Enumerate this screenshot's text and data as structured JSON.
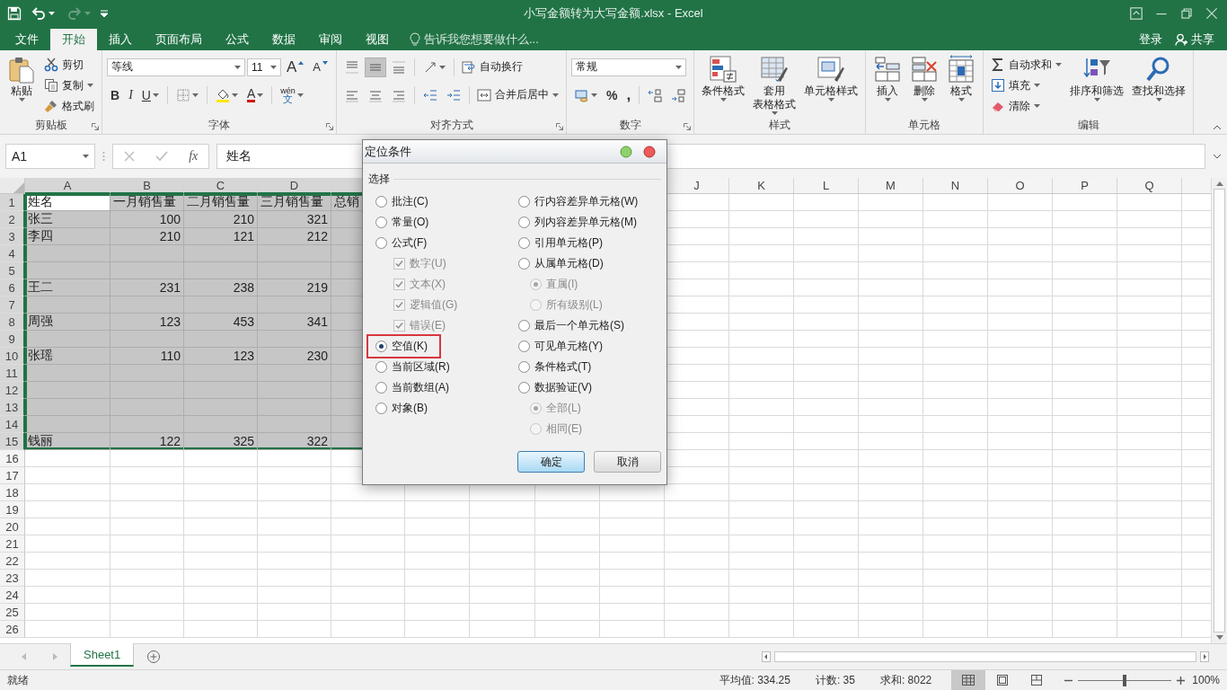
{
  "title_bar": {
    "title": "小写金额转为大写金额.xlsx - Excel",
    "redo_disabled": true
  },
  "tabs": [
    {
      "label": "文件",
      "selected": false
    },
    {
      "label": "开始",
      "selected": true
    },
    {
      "label": "插入",
      "selected": false
    },
    {
      "label": "页面布局",
      "selected": false
    },
    {
      "label": "公式",
      "selected": false
    },
    {
      "label": "数据",
      "selected": false
    },
    {
      "label": "审阅",
      "selected": false
    },
    {
      "label": "视图",
      "selected": false
    }
  ],
  "tell_me": "告诉我您想要做什么...",
  "sign_in": "登录",
  "share": "共享",
  "ribbon": {
    "groups": [
      {
        "label": "剪贴板",
        "launcher": true,
        "columns": [
          {
            "kind": "large",
            "lines": [
              "粘贴"
            ],
            "dropdown": true
          },
          {
            "kind": "stack",
            "items": [
              {
                "kind": "small",
                "label": "剪切",
                "dropdown": false
              },
              {
                "kind": "small",
                "label": "复制",
                "dropdown": true
              },
              {
                "kind": "small",
                "label": "格式刷",
                "dropdown": false
              }
            ]
          }
        ]
      },
      {
        "label": "字体",
        "launcher": true,
        "columns": [
          {
            "kind": "rows",
            "rows": [
              {
                "controls": [
                  {
                    "kind": "field",
                    "value": "等线"
                  },
                  {
                    "kind": "field",
                    "value": "11"
                  },
                  {
                    "kind": "glyph",
                    "text": "A",
                    "dropdown": false
                  },
                  {
                    "kind": "glyph",
                    "text": "A",
                    "dropdown": false
                  }
                ]
              },
              {
                "controls": [
                  {
                    "kind": "glyph",
                    "text": "B",
                    "dropdown": false
                  },
                  {
                    "kind": "glyph",
                    "text": "I",
                    "dropdown": false
                  },
                  {
                    "kind": "glyph",
                    "text": "U",
                    "dropdown": true
                  },
                  {
                    "kind": "separator"
                  },
                  {
                    "kind": "icon",
                    "dropdown": true
                  },
                  {
                    "kind": "separator"
                  },
                  {
                    "kind": "icon",
                    "dropdown": true
                  },
                  {
                    "kind": "glyph",
                    "text": "A",
                    "dropdown": true
                  },
                  {
                    "kind": "separator"
                  },
                  {
                    "kind": "glyph",
                    "text": "文",
                    "ruby": "wén",
                    "dropdown": true
                  }
                ]
              }
            ]
          }
        ]
      },
      {
        "label": "对齐方式",
        "launcher": true,
        "columns": [
          {
            "kind": "rows",
            "rows": [
              {
                "controls": [
                  {
                    "kind": "icon",
                    "dropdown": false,
                    "selected": false
                  },
                  {
                    "kind": "icon",
                    "dropdown": false,
                    "selected": true
                  },
                  {
                    "kind": "icon",
                    "dropdown": false,
                    "selected": false
                  },
                  {
                    "kind": "separator"
                  },
                  {
                    "kind": "icon",
                    "dropdown": true
                  },
                  {
                    "kind": "separator"
                  },
                  {
                    "kind": "small",
                    "label": "自动换行",
                    "dropdown": false
                  }
                ]
              },
              {
                "controls": [
                  {
                    "kind": "icon",
                    "dropdown": false,
                    "selected": false
                  },
                  {
                    "kind": "icon",
                    "dropdown": false,
                    "selected": false
                  },
                  {
                    "kind": "icon",
                    "dropdown": false,
                    "selected": false
                  },
                  {
                    "kind": "separator"
                  },
                  {
                    "kind": "icon",
                    "dropdown": false
                  },
                  {
                    "kind": "icon",
                    "dropdown": false
                  },
                  {
                    "kind": "separator"
                  },
                  {
                    "kind": "small",
                    "label": "合并后居中",
                    "dropdown": true
                  }
                ]
              }
            ]
          }
        ]
      },
      {
        "label": "数字",
        "launcher": true,
        "columns": [
          {
            "kind": "rows",
            "rows": [
              {
                "controls": [
                  {
                    "kind": "field",
                    "value": "常规"
                  }
                ]
              },
              {
                "controls": [
                  {
                    "kind": "icon",
                    "dropdown": true
                  },
                  {
                    "kind": "glyph",
                    "text": "%",
                    "dropdown": false
                  },
                  {
                    "kind": "glyph",
                    "text": ",",
                    "dropdown": false
                  },
                  {
                    "kind": "separator"
                  },
                  {
                    "kind": "icon",
                    "dropdown": false
                  },
                  {
                    "kind": "icon",
                    "dropdown": false
                  }
                ]
              }
            ]
          }
        ]
      },
      {
        "label": "样式",
        "launcher": false,
        "columns": [
          {
            "kind": "large",
            "lines": [
              "条件格式"
            ],
            "dropdown": true
          },
          {
            "kind": "large",
            "lines": [
              "套用",
              "表格格式"
            ],
            "dropdown": true
          },
          {
            "kind": "large",
            "lines": [
              "单元格样式"
            ],
            "dropdown": true
          }
        ]
      },
      {
        "label": "单元格",
        "launcher": false,
        "columns": [
          {
            "kind": "large",
            "lines": [
              "插入"
            ],
            "dropdown": true
          },
          {
            "kind": "large",
            "lines": [
              "删除"
            ],
            "dropdown": true
          },
          {
            "kind": "large",
            "lines": [
              "格式"
            ],
            "dropdown": true
          }
        ]
      },
      {
        "label": "编辑",
        "launcher": false,
        "columns": [
          {
            "kind": "stack",
            "items": [
              {
                "kind": "small",
                "label": "自动求和",
                "dropdown": true
              },
              {
                "kind": "small",
                "label": "填充",
                "dropdown": true
              },
              {
                "kind": "small",
                "label": "清除",
                "dropdown": true
              }
            ]
          },
          {
            "kind": "large",
            "lines": [
              "排序和筛选"
            ],
            "dropdown": true
          },
          {
            "kind": "large",
            "lines": [
              "查找和选择"
            ],
            "dropdown": true
          }
        ]
      }
    ]
  },
  "formula_bar": {
    "name_box": "A1",
    "fx": "fx",
    "formula": "姓名"
  },
  "sheet": {
    "columns": [
      {
        "kind": "header",
        "letter": "A",
        "selected": true
      },
      {
        "kind": "header",
        "letter": "B",
        "selected": true
      },
      {
        "kind": "header",
        "letter": "C",
        "selected": true
      },
      {
        "kind": "header",
        "letter": "D",
        "selected": true
      },
      {
        "kind": "covered",
        "selected": true
      },
      {
        "kind": "covered"
      },
      {
        "kind": "covered"
      },
      {
        "kind": "covered"
      },
      {
        "kind": "covered"
      },
      {
        "kind": "header",
        "letter": "J",
        "selected": false
      },
      {
        "kind": "header",
        "letter": "K",
        "selected": false
      },
      {
        "kind": "header",
        "letter": "L",
        "selected": false
      },
      {
        "kind": "header",
        "letter": "M",
        "selected": false
      },
      {
        "kind": "header",
        "letter": "N",
        "selected": false
      },
      {
        "kind": "header",
        "letter": "O",
        "selected": false
      },
      {
        "kind": "header",
        "letter": "P",
        "selected": false
      },
      {
        "kind": "header",
        "letter": "Q",
        "selected": false
      }
    ],
    "rows": [
      {
        "number": "1",
        "selected": true,
        "cells": [
          {
            "text": "姓名",
            "active": true
          },
          {
            "text": "一月销售量"
          },
          {
            "text": "二月销售量"
          },
          {
            "text": "三月销售量"
          },
          {
            "text": "总销"
          }
        ]
      },
      {
        "number": "2",
        "selected": true,
        "cells": [
          {
            "text": "张三"
          },
          {
            "text": "100"
          },
          {
            "text": "210"
          },
          {
            "text": "321"
          }
        ]
      },
      {
        "number": "3",
        "selected": true,
        "cells": [
          {
            "text": "李四"
          },
          {
            "text": "210"
          },
          {
            "text": "121"
          },
          {
            "text": "212"
          }
        ]
      },
      {
        "number": "4",
        "selected": true
      },
      {
        "number": "5",
        "selected": true
      },
      {
        "number": "6",
        "selected": true,
        "cells": [
          {
            "text": "王二"
          },
          {
            "text": "231"
          },
          {
            "text": "238"
          },
          {
            "text": "219"
          }
        ]
      },
      {
        "number": "7",
        "selected": true
      },
      {
        "number": "8",
        "selected": true,
        "cells": [
          {
            "text": "周强"
          },
          {
            "text": "123"
          },
          {
            "text": "453"
          },
          {
            "text": "341"
          }
        ]
      },
      {
        "number": "9",
        "selected": true
      },
      {
        "number": "10",
        "selected": true,
        "cells": [
          {
            "text": "张瑶"
          },
          {
            "text": "110"
          },
          {
            "text": "123"
          },
          {
            "text": "230"
          }
        ]
      },
      {
        "number": "11",
        "selected": true
      },
      {
        "number": "12",
        "selected": true
      },
      {
        "number": "13",
        "selected": true
      },
      {
        "number": "14",
        "selected": true
      },
      {
        "number": "15",
        "selected": true,
        "cells": [
          {
            "text": "钱丽"
          },
          {
            "text": "122"
          },
          {
            "text": "325"
          },
          {
            "text": "322"
          }
        ]
      },
      {
        "number": "16",
        "selected": false
      },
      {
        "number": "17",
        "selected": false
      },
      {
        "number": "18",
        "selected": false
      },
      {
        "number": "19",
        "selected": false
      },
      {
        "number": "20",
        "selected": false
      },
      {
        "number": "21",
        "selected": false
      },
      {
        "number": "22",
        "selected": false
      },
      {
        "number": "23",
        "selected": false
      },
      {
        "number": "24",
        "selected": false
      },
      {
        "number": "25",
        "selected": false
      },
      {
        "number": "26",
        "selected": false
      }
    ]
  },
  "sheet_tabs": [
    {
      "label": "Sheet1",
      "selected": true
    }
  ],
  "status_bar": {
    "status": "就绪",
    "average": "平均值: 334.25",
    "count": "计数: 35",
    "sum": "求和: 8022",
    "views": [
      {
        "selected": true
      },
      {
        "selected": false
      },
      {
        "selected": false
      }
    ],
    "zoom": {
      "level": 0.5,
      "reading": "100%"
    }
  },
  "dialog": {
    "title": "定位条件",
    "group_label": "选择",
    "left": [
      {
        "kind": "radio",
        "label": "批注(C)",
        "selected": false,
        "disabled": false,
        "highlighted": false
      },
      {
        "kind": "radio",
        "label": "常量(O)",
        "selected": false,
        "disabled": false,
        "highlighted": false
      },
      {
        "kind": "radio",
        "label": "公式(F)",
        "selected": false,
        "disabled": false,
        "highlighted": false,
        "children": [
          {
            "kind": "checkbox",
            "label": "数字(U)",
            "checked": true,
            "disabled": true
          },
          {
            "kind": "checkbox",
            "label": "文本(X)",
            "checked": true,
            "disabled": true
          },
          {
            "kind": "checkbox",
            "label": "逻辑值(G)",
            "checked": true,
            "disabled": true
          },
          {
            "kind": "checkbox",
            "label": "错误(E)",
            "checked": true,
            "disabled": true
          }
        ]
      },
      {
        "kind": "radio",
        "label": "空值(K)",
        "selected": true,
        "disabled": false,
        "highlighted": true
      },
      {
        "kind": "radio",
        "label": "当前区域(R)",
        "selected": false,
        "disabled": false,
        "highlighted": false
      },
      {
        "kind": "radio",
        "label": "当前数组(A)",
        "selected": false,
        "disabled": false,
        "highlighted": false
      },
      {
        "kind": "radio",
        "label": "对象(B)",
        "selected": false,
        "disabled": false,
        "highlighted": false
      }
    ],
    "right": [
      {
        "kind": "radio",
        "label": "行内容差异单元格(W)",
        "selected": false,
        "disabled": false,
        "highlighted": false
      },
      {
        "kind": "radio",
        "label": "列内容差异单元格(M)",
        "selected": false,
        "disabled": false,
        "highlighted": false
      },
      {
        "kind": "radio",
        "label": "引用单元格(P)",
        "selected": false,
        "disabled": false,
        "highlighted": false
      },
      {
        "kind": "radio",
        "label": "从属单元格(D)",
        "selected": false,
        "disabled": false,
        "highlighted": false,
        "children": [
          {
            "kind": "radio",
            "label": "直属(I)",
            "selected": true,
            "disabled": true
          },
          {
            "kind": "radio",
            "label": "所有级别(L)",
            "selected": false,
            "disabled": true
          }
        ]
      },
      {
        "kind": "radio",
        "label": "最后一个单元格(S)",
        "selected": false,
        "disabled": false,
        "highlighted": false
      },
      {
        "kind": "radio",
        "label": "可见单元格(Y)",
        "selected": false,
        "disabled": false,
        "highlighted": false
      },
      {
        "kind": "radio",
        "label": "条件格式(T)",
        "selected": false,
        "disabled": false,
        "highlighted": false
      },
      {
        "kind": "radio",
        "label": "数据验证(V)",
        "selected": false,
        "disabled": false,
        "highlighted": false,
        "children": [
          {
            "kind": "radio",
            "label": "全部(L)",
            "selected": true,
            "disabled": true
          },
          {
            "kind": "radio",
            "label": "相同(E)",
            "selected": false,
            "disabled": true
          }
        ]
      }
    ],
    "buttons": [
      {
        "label": "确定",
        "default": true
      },
      {
        "label": "取消",
        "default": false
      }
    ]
  }
}
